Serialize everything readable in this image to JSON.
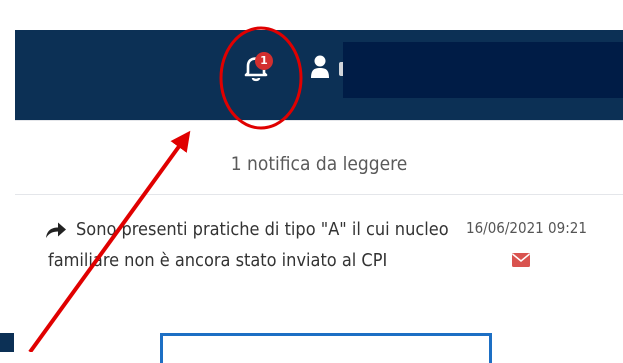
{
  "header": {
    "notifications_badge": "1",
    "bell_icon": "bell-icon",
    "user_icon": "user-icon"
  },
  "notifications_panel": {
    "unread_header": "1 notifica da leggere",
    "items": [
      {
        "icon": "share-arrow-icon",
        "message": "Sono presenti pratiche di tipo \"A\" il cui nucleo familiare non è ancora stato inviato al CPI",
        "timestamp": "16/06/2021 09:21",
        "status_icon": "envelope-icon"
      }
    ]
  },
  "colors": {
    "header_bg": "#0c3055",
    "badge": "#d32f2f",
    "envelope": "#d9534f",
    "annotation": "#e00000",
    "button_border": "#1d6fc4"
  }
}
